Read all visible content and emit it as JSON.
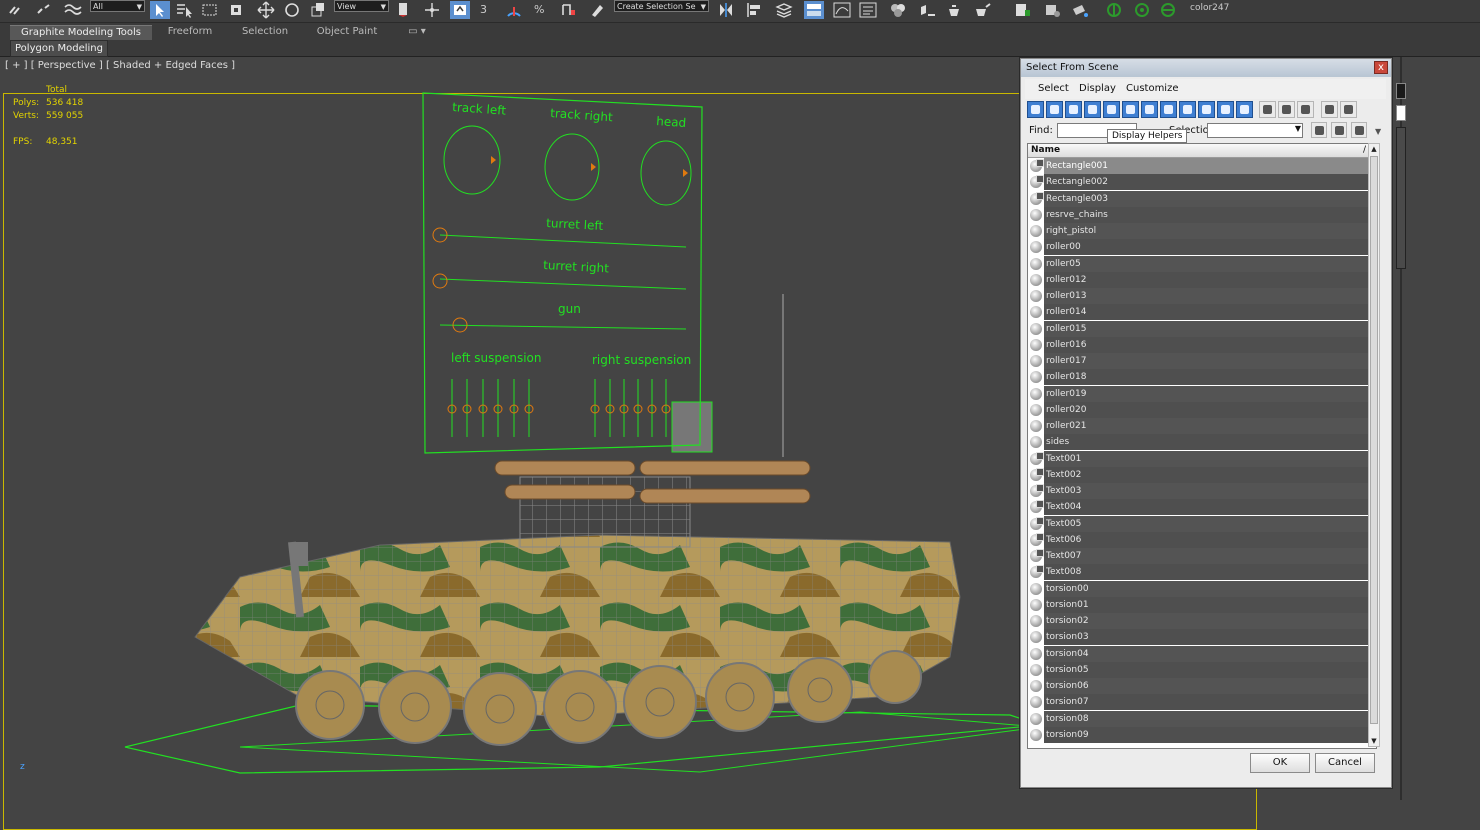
{
  "toolbar": {
    "filter_dropdown": "All",
    "view_dropdown": "View",
    "snap_label": "3",
    "percent_label": "%",
    "selection_set_dropdown": "Create Selection Se",
    "color_label": "color247"
  },
  "ribbon": {
    "tabs": [
      "Graphite Modeling Tools",
      "Freeform",
      "Selection",
      "Object Paint"
    ],
    "subtab": "Polygon Modeling"
  },
  "viewport": {
    "label": "[ + ] [ Perspective ] [ Shaded + Edged Faces ]",
    "stats": {
      "total_label": "Total",
      "polys_label": "Polys:",
      "polys_value": "536 418",
      "verts_label": "Verts:",
      "verts_value": "559 055",
      "fps_label": "FPS:",
      "fps_value": "48,351"
    },
    "rig_labels": {
      "track_left": "track left",
      "track_right": "track right",
      "head": "head",
      "turret_left": "turret left",
      "turret_right": "turret right",
      "gun": "gun",
      "left_suspension": "left suspension",
      "right_suspension": "right suspension"
    },
    "axis_label": "z",
    "colors": {
      "rig": "#22e022",
      "marker": "#e07a10",
      "border": "#c9b800"
    }
  },
  "dialog": {
    "title": "Select From Scene",
    "close_glyph": "x",
    "menu": [
      "Select",
      "Display",
      "Customize"
    ],
    "find_label": "Find:",
    "find_value": "",
    "selection_set_label": "Selection Set:",
    "tooltip": "Display Helpers",
    "list_header": {
      "name": "Name",
      "sort_glyph": "/"
    },
    "items": [
      {
        "name": "Rectangle001",
        "type": "rect",
        "selected": true
      },
      {
        "name": "Rectangle002",
        "type": "rect"
      },
      {
        "name": "Rectangle003",
        "type": "rect"
      },
      {
        "name": "resrve_chains",
        "type": "sphere"
      },
      {
        "name": "right_pistol",
        "type": "sphere"
      },
      {
        "name": "roller00",
        "type": "sphere"
      },
      {
        "name": "roller05",
        "type": "sphere"
      },
      {
        "name": "roller012",
        "type": "sphere"
      },
      {
        "name": "roller013",
        "type": "sphere"
      },
      {
        "name": "roller014",
        "type": "sphere"
      },
      {
        "name": "roller015",
        "type": "sphere"
      },
      {
        "name": "roller016",
        "type": "sphere"
      },
      {
        "name": "roller017",
        "type": "sphere"
      },
      {
        "name": "roller018",
        "type": "sphere"
      },
      {
        "name": "roller019",
        "type": "sphere"
      },
      {
        "name": "roller020",
        "type": "sphere"
      },
      {
        "name": "roller021",
        "type": "sphere"
      },
      {
        "name": "sides",
        "type": "sphere"
      },
      {
        "name": "Text001",
        "type": "rect"
      },
      {
        "name": "Text002",
        "type": "rect"
      },
      {
        "name": "Text003",
        "type": "rect"
      },
      {
        "name": "Text004",
        "type": "rect"
      },
      {
        "name": "Text005",
        "type": "rect"
      },
      {
        "name": "Text006",
        "type": "rect"
      },
      {
        "name": "Text007",
        "type": "rect"
      },
      {
        "name": "Text008",
        "type": "rect"
      },
      {
        "name": "torsion00",
        "type": "sphere"
      },
      {
        "name": "torsion01",
        "type": "sphere"
      },
      {
        "name": "torsion02",
        "type": "sphere"
      },
      {
        "name": "torsion03",
        "type": "sphere"
      },
      {
        "name": "torsion04",
        "type": "sphere"
      },
      {
        "name": "torsion05",
        "type": "sphere"
      },
      {
        "name": "torsion06",
        "type": "sphere"
      },
      {
        "name": "torsion07",
        "type": "sphere"
      },
      {
        "name": "torsion08",
        "type": "sphere"
      },
      {
        "name": "torsion09",
        "type": "sphere"
      }
    ],
    "ok_label": "OK",
    "cancel_label": "Cancel"
  }
}
